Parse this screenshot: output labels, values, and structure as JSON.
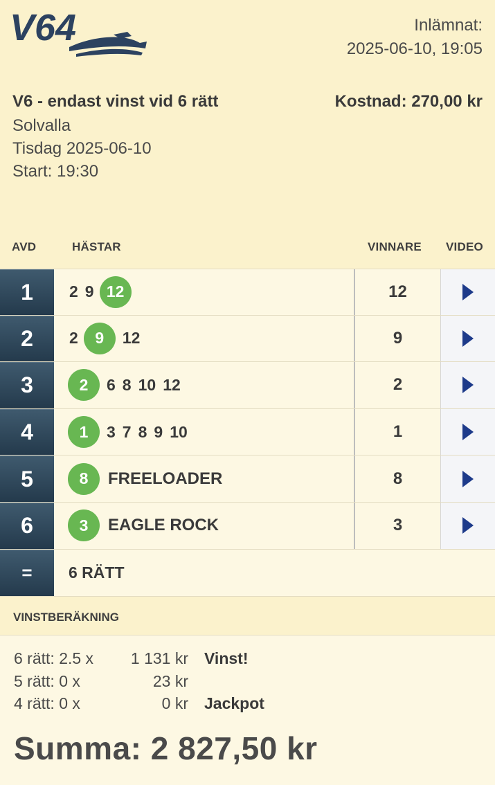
{
  "header": {
    "logo_text": "V64",
    "submitted_label": "Inlämnat:",
    "submitted_time": "2025-06-10, 19:05",
    "game_title": "V6 - endast vinst vid 6 rätt",
    "cost": "Kostnad: 270,00 kr",
    "track": "Solvalla",
    "date": "Tisdag 2025-06-10",
    "start": "Start: 19:30"
  },
  "table": {
    "headers": {
      "avd": "AVD",
      "hastar": "HÄSTAR",
      "vinnare": "VINNARE",
      "video": "VIDEO"
    },
    "rows": [
      {
        "avd": "1",
        "horses": [
          "2",
          "9",
          "12"
        ],
        "winner": "12"
      },
      {
        "avd": "2",
        "horses": [
          "2",
          "9",
          "12"
        ],
        "winner": "9"
      },
      {
        "avd": "3",
        "horses": [
          "2",
          "6",
          "8",
          "10",
          "12"
        ],
        "winner": "2"
      },
      {
        "avd": "4",
        "horses": [
          "1",
          "3",
          "7",
          "8",
          "9",
          "10"
        ],
        "winner": "1"
      },
      {
        "avd": "5",
        "horses": [
          "8"
        ],
        "horse_name": "FREELOADER",
        "winner": "8"
      },
      {
        "avd": "6",
        "horses": [
          "3"
        ],
        "horse_name": "EAGLE ROCK",
        "winner": "3"
      }
    ],
    "total": {
      "symbol": "=",
      "label": "6 RÄTT"
    }
  },
  "calc": {
    "title": "VINSTBERÄKNING",
    "lines": [
      {
        "label": "6 rätt: 2.5 x",
        "amount": "1 131 kr",
        "note": "Vinst!"
      },
      {
        "label": "5 rätt: 0 x",
        "amount": "23 kr",
        "note": ""
      },
      {
        "label": "4 rätt: 0 x",
        "amount": "0 kr",
        "note": "Jackpot"
      }
    ],
    "summa": "Summa: 2 827,50 kr"
  },
  "colors": {
    "background": "#fdf6d6",
    "avd_cell": "#2f4a5e",
    "winner_circle": "#68b752",
    "play_icon": "#1d3a8a"
  },
  "icons": {
    "video": "play-icon",
    "logo": "v64-horse-logo"
  }
}
